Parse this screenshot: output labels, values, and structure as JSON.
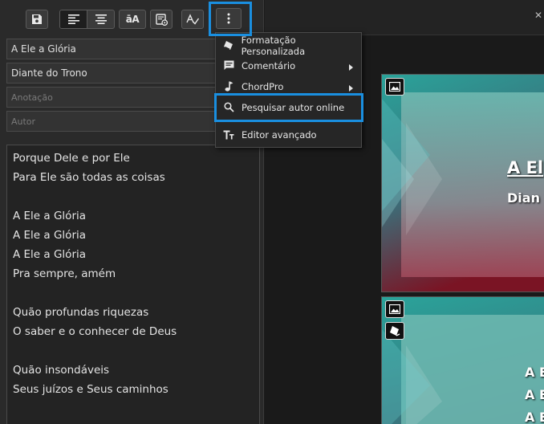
{
  "metadata_fields": {
    "title_value": "A Ele a Glória",
    "artist_value": "Diante do Trono",
    "annotation_placeholder": "Anotação",
    "author_placeholder": "Autor"
  },
  "toolbar": {
    "font_button_label": "āA"
  },
  "lyrics": [
    "Porque Dele e por Ele",
    "Para Ele são todas as coisas",
    "",
    "A Ele a Glória",
    "A Ele a Glória",
    "A Ele a Glória",
    "Pra sempre, amém",
    "",
    "Quão profundas riquezas",
    "O saber e o conhecer de Deus",
    "",
    "Quão insondáveis",
    "Seus juízos e Seus caminhos"
  ],
  "menu": {
    "items": [
      {
        "label": "Formatação Personalizada",
        "icon": "eraser-icon",
        "has_submenu": false
      },
      {
        "label": "Comentário",
        "icon": "comment-icon",
        "has_submenu": true
      },
      {
        "label": "ChordPro",
        "icon": "music-note-icon",
        "has_submenu": true
      },
      {
        "label": "Pesquisar autor online",
        "icon": "search-icon",
        "has_submenu": false
      },
      {
        "label": "Editor avançado",
        "icon": "text-format-icon",
        "has_submenu": false
      }
    ]
  },
  "preview": {
    "slide1_title": "A El",
    "slide1_subtitle": "Dian",
    "slide2_lines": [
      "A E",
      "A E",
      "A E"
    ]
  },
  "colors": {
    "highlight": "#1a8fe0",
    "panel": "#2a2a2a",
    "menu_bg": "#262626"
  }
}
